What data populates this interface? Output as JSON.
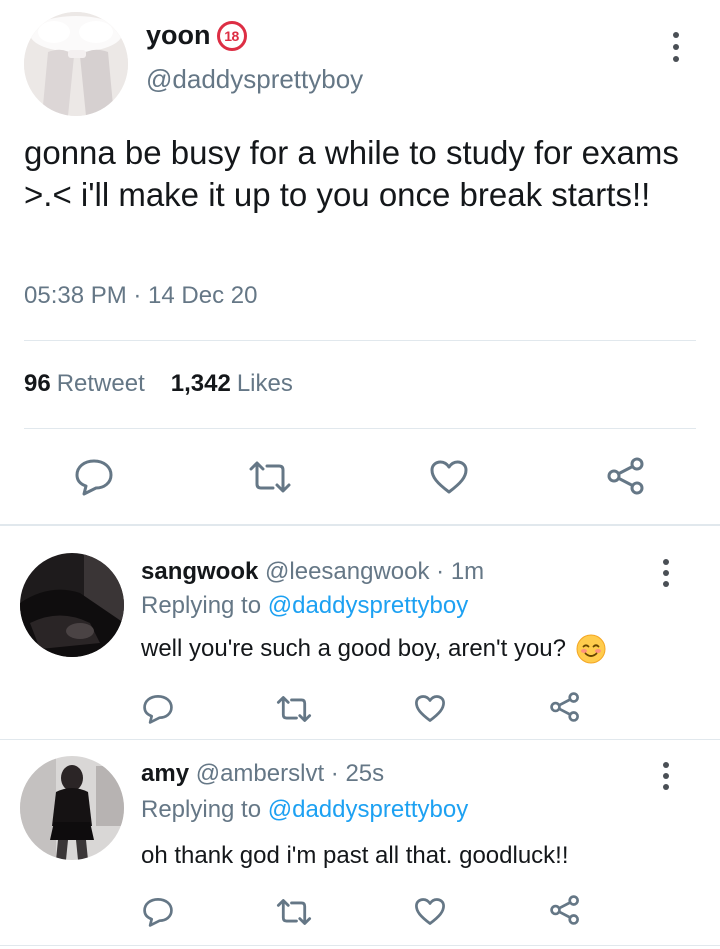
{
  "main_tweet": {
    "display_name": "yoon",
    "badge": "18",
    "handle": "@daddysprettyboy",
    "text": "gonna be busy for a while to study for exams >.< i'll make it up to you once break starts!!",
    "timestamp": "05:38 PM · 14 Dec 20",
    "retweets": {
      "count": "96",
      "label": "Retweet"
    },
    "likes": {
      "count": "1,342",
      "label": "Likes"
    }
  },
  "replies": [
    {
      "display_name": "sangwook",
      "handle": "@leesangwook",
      "time": " · 1m",
      "replying_prefix": "Replying to ",
      "replying_to": "@daddysprettyboy",
      "text": "well you're such a good boy, aren't you?",
      "emoji": "smiling-face-icon"
    },
    {
      "display_name": "amy",
      "handle": "@amberslvt",
      "time": " · 25s",
      "replying_prefix": "Replying to ",
      "replying_to": "@daddysprettyboy",
      "text": "oh thank god i'm past all that. goodluck!!"
    }
  ],
  "colors": {
    "accent": "#1da1f2",
    "secondary_text": "#657786",
    "icon": "#657786",
    "divider": "#e1e8ed",
    "badge_red": "#dd2e44"
  }
}
